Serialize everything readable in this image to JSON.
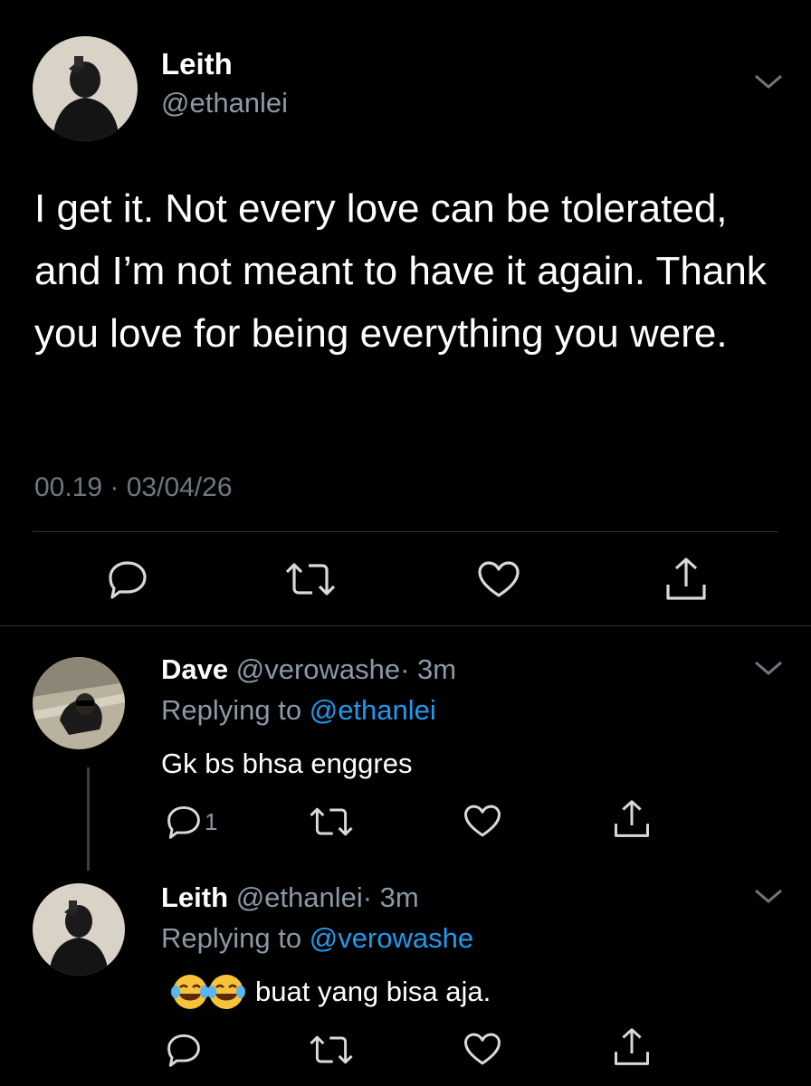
{
  "main_tweet": {
    "name": "Leith",
    "handle": "@ethanlei",
    "text": "I get it. Not every love can be tolerated, and I’m not meant to have it again. Thank you love for being everything you were.",
    "timestamp": "00.19 · 03/04/26",
    "icons": [
      "reply-icon",
      "retweet-icon",
      "like-icon",
      "share-icon"
    ]
  },
  "replies": [
    {
      "name": "Dave",
      "handle": "@verowashe",
      "time": "· 3m",
      "replying_label": "Replying to",
      "replying_to": "@ethanlei",
      "text": "Gk bs bhsa enggres",
      "reply_count": "1"
    },
    {
      "name": "Leith",
      "handle": "@ethanlei",
      "time": "· 3m",
      "replying_label": "Replying to",
      "replying_to": "@verowashe",
      "emoji": "😂😂",
      "text": "buat yang bisa aja."
    }
  ],
  "colors": {
    "background": "#000000",
    "primary_text": "#ffffff",
    "secondary_text": "#8b98a5",
    "mention": "#1d9bf0",
    "divider": "#2f3336"
  }
}
